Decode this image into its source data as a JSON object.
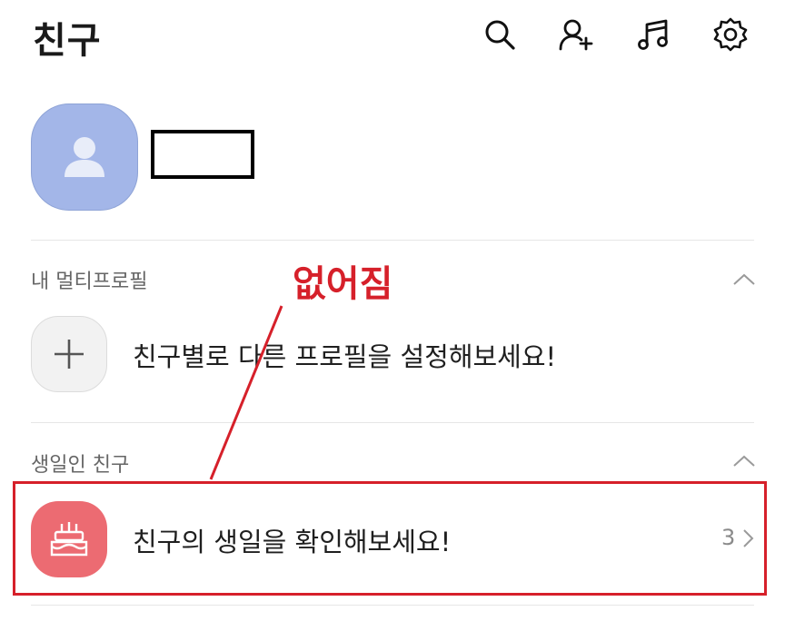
{
  "header": {
    "title": "친구",
    "icons": [
      "search-icon",
      "add-friend-icon",
      "music-icon",
      "settings-icon"
    ]
  },
  "multi_profile": {
    "section_label": "내 멀티프로필",
    "prompt": "친구별로 다른 프로필을 설정해보세요!"
  },
  "birthday": {
    "section_label": "생일인 친구",
    "prompt": "친구의 생일을 확인해보세요!",
    "count": "3"
  },
  "annotation": {
    "text": "없어짐",
    "color": "#d6202a"
  },
  "colors": {
    "avatar_bg": "#a3b6e8",
    "cake_bg": "#ec6b72",
    "annotation": "#d6202a"
  }
}
